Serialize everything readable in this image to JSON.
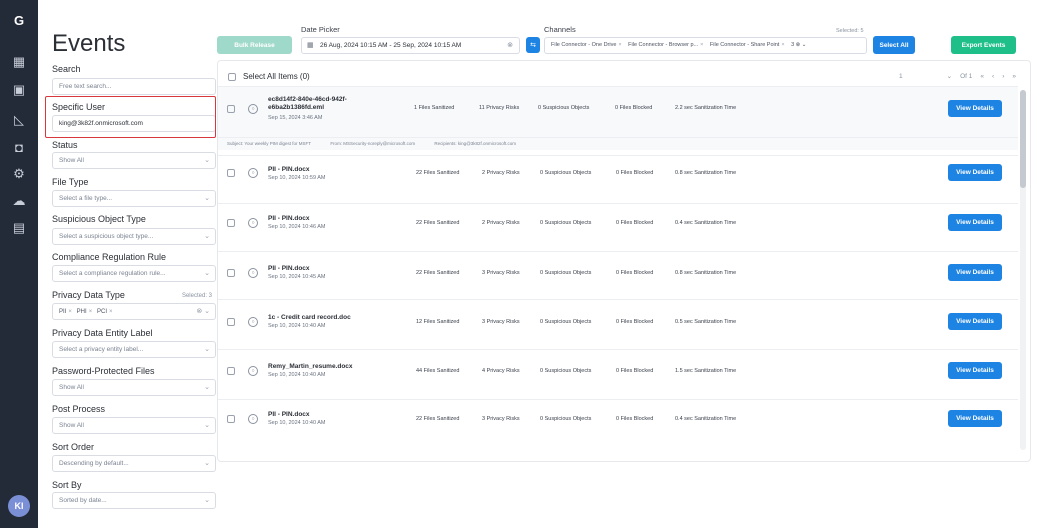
{
  "rail": {
    "icons": [
      "logo-icon",
      "grid-icon",
      "archive-icon",
      "chart-icon",
      "users-icon",
      "settings-icon",
      "cloud-icon",
      "document-icon"
    ],
    "avatar": "KI"
  },
  "sidebar": {
    "title": "Events",
    "search": {
      "label": "Search",
      "placeholder": "Free text search..."
    },
    "specific_user": {
      "label": "Specific User",
      "value": "king@3k82f.onmicrosoft.com"
    },
    "status": {
      "label": "Status",
      "value": "Show All"
    },
    "file_type": {
      "label": "File Type",
      "placeholder": "Select a file type..."
    },
    "suspicious": {
      "label": "Suspicious Object Type",
      "placeholder": "Select a suspicious object type..."
    },
    "compliance": {
      "label": "Compliance Regulation Rule",
      "placeholder": "Select a compliance regulation rule..."
    },
    "privacy_type": {
      "label": "Privacy Data Type",
      "selected": "Selected: 3",
      "chips": [
        "PII",
        "PHI",
        "PCI"
      ]
    },
    "privacy_label": {
      "label": "Privacy Data Entity Label",
      "placeholder": "Select a privacy entity label..."
    },
    "password": {
      "label": "Password-Protected Files",
      "value": "Show All"
    },
    "post_process": {
      "label": "Post Process",
      "value": "Show All"
    },
    "sort_order": {
      "label": "Sort Order",
      "placeholder": "Descending by default..."
    },
    "sort_by": {
      "label": "Sort By",
      "placeholder": "Sorted by date..."
    }
  },
  "topbar": {
    "bulk_release": "Bulk Release",
    "date_picker_label": "Date Picker",
    "date_range": "26 Aug, 2024 10:15 AM - 25 Sep, 2024 10:15 AM",
    "channels_label": "Channels",
    "channels_selected": "Selected: 5",
    "channels": [
      "File Connector - One Drive",
      "File Connector - Browser p...",
      "File Connector - Share Point"
    ],
    "channels_more": "3",
    "select_all": "Select All",
    "export": "Export Events"
  },
  "list": {
    "select_all": "Select All Items (0)",
    "page": "1",
    "of": "Of 1",
    "view_details": "View Details",
    "rows": [
      {
        "name": "ec8d14f2-840e-46cd-942f-e6ba2b1386fd.eml",
        "date": "Sep 15, 2024 3:46 AM",
        "sanitized": "1 Files Sanitized",
        "privacy": "11 Privacy Risks",
        "suspicious": "0 Suspicious Objects",
        "blocked": "0 Files Blocked",
        "time": "2.2 sec Sanitization Time",
        "subject": "Subject: Your weekly PIM digest for MSFT",
        "from": "From: MSSecurity-noreply@microsoft.com",
        "recipients": "Recipients: king@3k82f.onmicrosoft.com"
      },
      {
        "name": "PII - PIN.docx",
        "date": "Sep 10, 2024 10:59 AM",
        "sanitized": "22 Files Sanitized",
        "privacy": "2 Privacy Risks",
        "suspicious": "0 Suspicious Objects",
        "blocked": "0 Files Blocked",
        "time": "0.8 sec Sanitization Time"
      },
      {
        "name": "PII - PIN.docx",
        "date": "Sep 10, 2024 10:46 AM",
        "sanitized": "22 Files Sanitized",
        "privacy": "2 Privacy Risks",
        "suspicious": "0 Suspicious Objects",
        "blocked": "0 Files Blocked",
        "time": "0.4 sec Sanitization Time"
      },
      {
        "name": "PII - PIN.docx",
        "date": "Sep 10, 2024 10:45 AM",
        "sanitized": "22 Files Sanitized",
        "privacy": "3 Privacy Risks",
        "suspicious": "0 Suspicious Objects",
        "blocked": "0 Files Blocked",
        "time": "0.8 sec Sanitization Time"
      },
      {
        "name": "1c - Credit card record.doc",
        "date": "Sep 10, 2024 10:40 AM",
        "sanitized": "12 Files Sanitized",
        "privacy": "3 Privacy Risks",
        "suspicious": "0 Suspicious Objects",
        "blocked": "0 Files Blocked",
        "time": "0.5 sec Sanitization Time"
      },
      {
        "name": "Remy_Martin_resume.docx",
        "date": "Sep 10, 2024 10:40 AM",
        "sanitized": "44 Files Sanitized",
        "privacy": "4 Privacy Risks",
        "suspicious": "0 Suspicious Objects",
        "blocked": "0 Files Blocked",
        "time": "1.5 sec Sanitization Time"
      },
      {
        "name": "PII - PIN.docx",
        "date": "Sep 10, 2024 10:40 AM",
        "sanitized": "22 Files Sanitized",
        "privacy": "3 Privacy Risks",
        "suspicious": "0 Suspicious Objects",
        "blocked": "0 Files Blocked",
        "time": "0.4 sec Sanitization Time"
      }
    ]
  }
}
